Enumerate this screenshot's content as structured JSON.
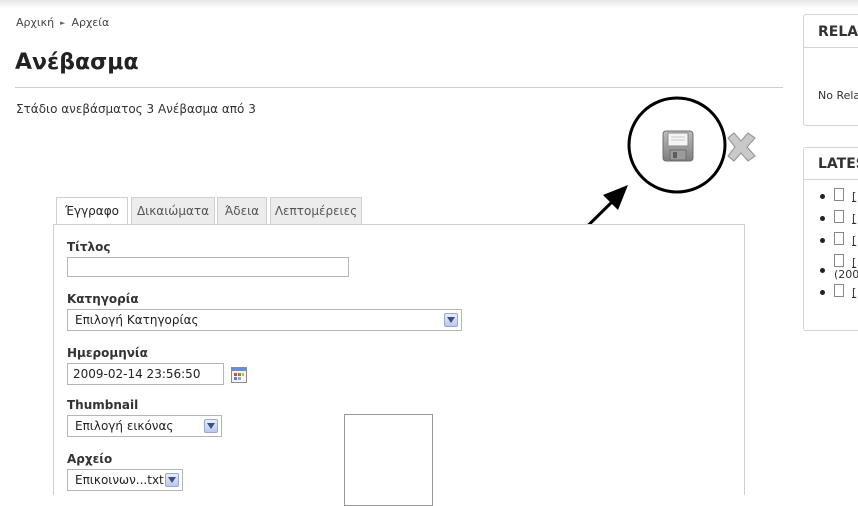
{
  "breadcrumb": {
    "home": "Αρχική",
    "current": "Αρχεία"
  },
  "page": {
    "title": "Ανέβασμα",
    "stage_text": "Στάδιο ανεβάσματος 3 Ανέβασμα από 3"
  },
  "toolbar": {
    "save_icon": "floppy-disk-icon",
    "cancel_icon": "x-cross-icon"
  },
  "tabs": [
    {
      "label": "Έγγραφο",
      "active": true
    },
    {
      "label": "Δικαιώματα",
      "active": false
    },
    {
      "label": "Άδεια",
      "active": false
    },
    {
      "label": "Λεπτομέρειες",
      "active": false
    }
  ],
  "form": {
    "title_label": "Τίτλος",
    "title_value": "",
    "category_label": "Κατηγορία",
    "category_value": "Επιλογή Κατηγορίας",
    "date_label": "Ημερομηνία",
    "date_value": "2009-02-14 23:56:50",
    "thumbnail_label": "Thumbnail",
    "thumbnail_value": "Επιλογή εικόνας",
    "file_label": "Αρχείο",
    "file_value": "Επικοινων...txt"
  },
  "sidebar": {
    "related_title": "RELA",
    "related_text": "No Rela",
    "latest_title": "LATES",
    "latest_items": [
      "[",
      "[",
      "[",
      "[",
      "(200",
      "["
    ]
  },
  "colors": {
    "accent_arrow": "#96a9d4",
    "border": "#cfcfcf"
  }
}
